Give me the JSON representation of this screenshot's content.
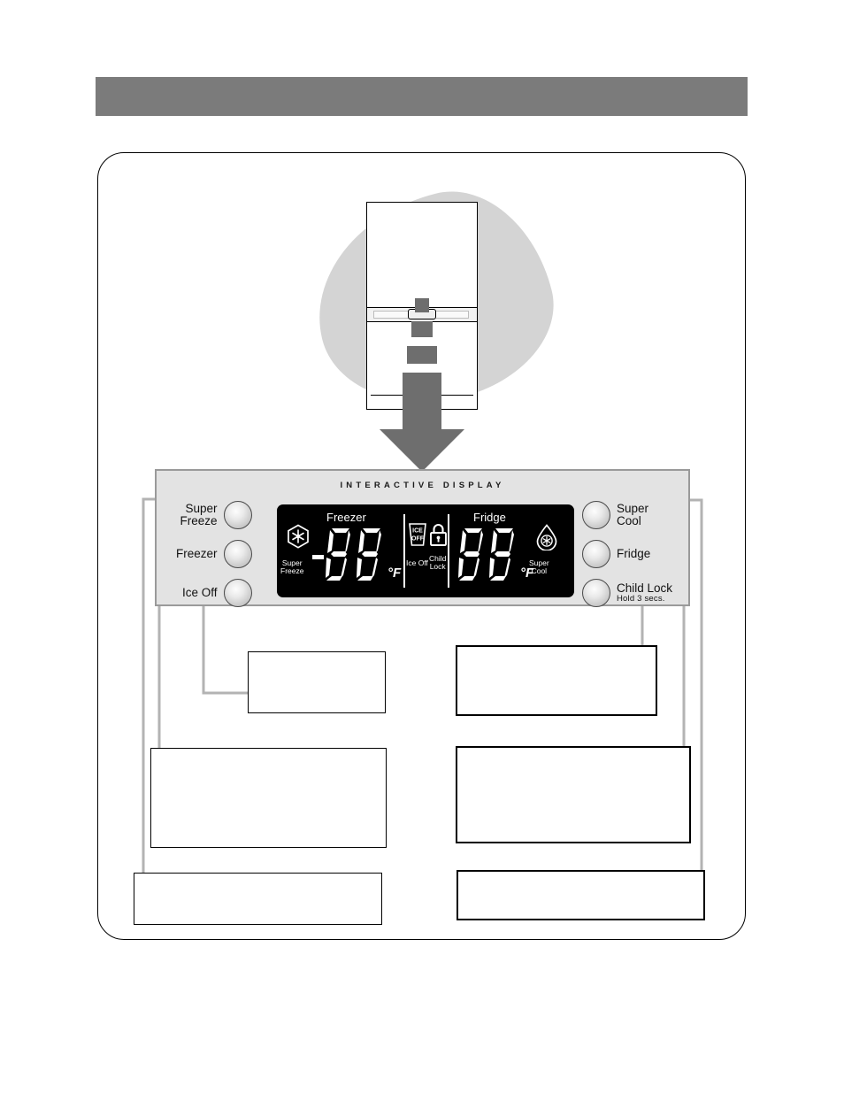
{
  "header": {
    "title": ""
  },
  "illustration": {
    "name": "refrigerator-diagram",
    "arrow_direction": "down"
  },
  "panel": {
    "title": "INTERACTIVE DISPLAY",
    "bezel_color": "#e3e3e3",
    "border_color": "#9a9a9a",
    "left_buttons": [
      {
        "label": "Super",
        "label2": "Freeze",
        "sub": ""
      },
      {
        "label": "Freezer",
        "label2": "",
        "sub": ""
      },
      {
        "label": "Ice Off",
        "label2": "",
        "sub": ""
      }
    ],
    "right_buttons": [
      {
        "label": "Super",
        "label2": "Cool",
        "sub": ""
      },
      {
        "label": "Fridge",
        "label2": "",
        "sub": ""
      },
      {
        "label": "Child Lock",
        "label2": "",
        "sub": "Hold  3 secs."
      }
    ]
  },
  "lcd": {
    "background": "#000000",
    "foreground": "#ffffff",
    "freezer": {
      "zone_label": "Freezer",
      "sign": "-",
      "digits": "88",
      "unit": "°F",
      "indicator_icon": "snowflake-hex-icon",
      "indicator_label_line1": "Super",
      "indicator_label_line2": "Freeze"
    },
    "center": {
      "ice_off_icon": "ice-off-cup-icon",
      "ice_off_text_line1": "ICE",
      "ice_off_text_line2": "OFF",
      "ice_off_label": "Ice Off",
      "child_lock_icon": "padlock-icon",
      "child_lock_label_line1": "Child",
      "child_lock_label_line2": "Lock"
    },
    "fridge": {
      "zone_label": "Fridge",
      "sign": "",
      "digits": "88",
      "unit": "°F",
      "indicator_icon": "water-drop-snowflake-icon",
      "indicator_label_line1": "Super",
      "indicator_label_line2": "Cool"
    }
  },
  "callouts": [
    {
      "id": "box-a",
      "text": ""
    },
    {
      "id": "box-b",
      "text": ""
    },
    {
      "id": "box-c",
      "text": ""
    },
    {
      "id": "box-d",
      "text": ""
    },
    {
      "id": "box-e",
      "text": ""
    },
    {
      "id": "box-f",
      "text": ""
    }
  ],
  "colors": {
    "header_band": "#7b7b7b",
    "blob": "#d4d4d4",
    "arrow": "#6e6e6e",
    "leader": "#b3b3b3",
    "frame_border": "#000000"
  }
}
